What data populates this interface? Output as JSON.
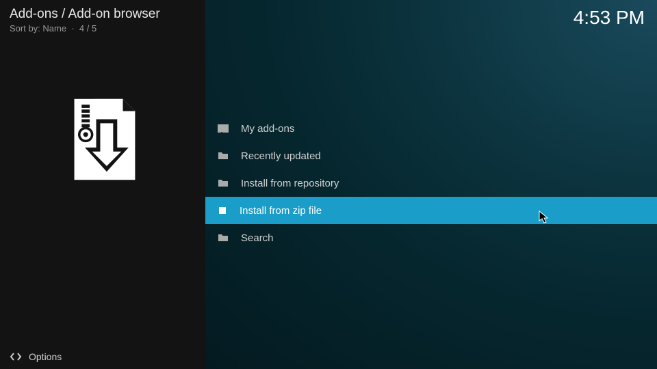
{
  "header": {
    "breadcrumb": "Add-ons / Add-on browser",
    "sort_label": "Sort by: Name",
    "counter": "4 / 5"
  },
  "clock": "4:53 PM",
  "menu": {
    "items": [
      {
        "label": "My add-ons",
        "icon": "folder",
        "selected": false
      },
      {
        "label": "Recently updated",
        "icon": "folder",
        "selected": false
      },
      {
        "label": "Install from repository",
        "icon": "folder",
        "selected": false
      },
      {
        "label": "Install from zip file",
        "icon": "zip",
        "selected": true
      },
      {
        "label": "Search",
        "icon": "folder",
        "selected": false
      }
    ]
  },
  "footer": {
    "options_label": "Options"
  }
}
